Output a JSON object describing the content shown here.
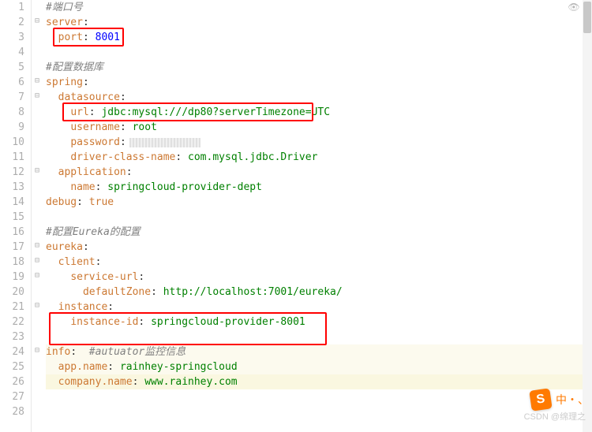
{
  "lines": {
    "l1": {
      "comment": "#端口号"
    },
    "l2": {
      "k1": "server",
      "colon": ":"
    },
    "l3": {
      "k1": "port",
      "colon": ": ",
      "v1": "8001"
    },
    "l5": {
      "comment": "#配置数据库"
    },
    "l6": {
      "k1": "spring",
      "colon": ":"
    },
    "l7": {
      "k1": "datasource",
      "colon": ":"
    },
    "l8": {
      "k1": "url",
      "colon": ": ",
      "v1": "jdbc:mysql:///dp80?serverTimezone=UTC"
    },
    "l9": {
      "k1": "username",
      "colon": ": ",
      "v1": "root"
    },
    "l10": {
      "k1": "password",
      "colon": ":"
    },
    "l11": {
      "k1": "driver-class-name",
      "colon": ": ",
      "v1": "com.mysql.jdbc.Driver"
    },
    "l12": {
      "k1": "application",
      "colon": ":"
    },
    "l13": {
      "k1": "name",
      "colon": ": ",
      "v1": "springcloud-provider-dept"
    },
    "l14": {
      "k1": "debug",
      "colon": ": ",
      "v1": "true"
    },
    "l16": {
      "comment": "#配置Eureka的配置"
    },
    "l17": {
      "k1": "eureka",
      "colon": ":"
    },
    "l18": {
      "k1": "client",
      "colon": ":"
    },
    "l19": {
      "k1": "service-url",
      "colon": ":"
    },
    "l20": {
      "k1": "defaultZone",
      "colon": ": ",
      "v1": "http://localhost:7001/eureka/"
    },
    "l21": {
      "k1": "instance",
      "colon": ":"
    },
    "l22": {
      "k1": "instance-id",
      "colon": ": ",
      "v1": "springcloud-provider-8001"
    },
    "l24": {
      "k1": "info",
      "colon": ":  ",
      "comment": "#autuator监控信息"
    },
    "l25": {
      "k1": "app.name",
      "colon": ": ",
      "v1": "rainhey-springcloud"
    },
    "l26": {
      "k1": "company.name",
      "colon": ": ",
      "v1": "www.rainhey.com"
    }
  },
  "line_numbers": [
    "1",
    "2",
    "3",
    "4",
    "5",
    "6",
    "7",
    "8",
    "9",
    "10",
    "11",
    "12",
    "13",
    "14",
    "15",
    "16",
    "17",
    "18",
    "19",
    "20",
    "21",
    "22",
    "23",
    "24",
    "25",
    "26",
    "27",
    "28"
  ],
  "watermark": "CSDN @绵理之",
  "badge": {
    "icon": "S",
    "text": "中・、"
  }
}
